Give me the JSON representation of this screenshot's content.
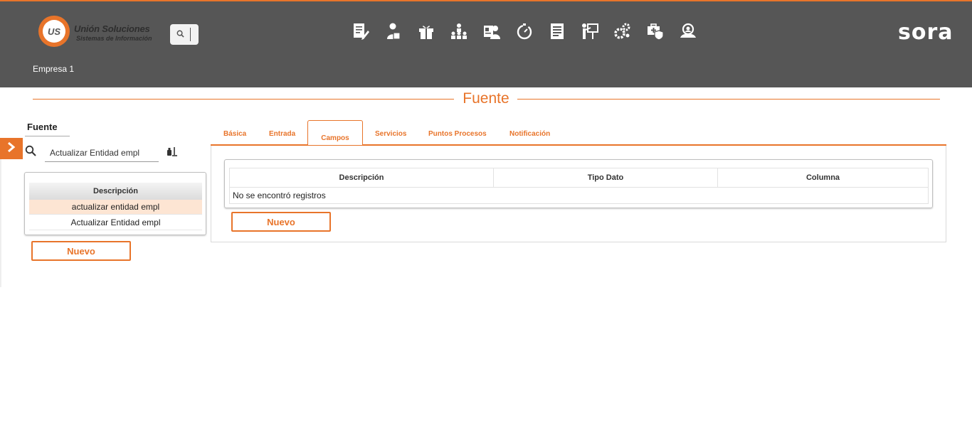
{
  "header": {
    "logo_title": "Unión Soluciones",
    "logo_subtitle": "Sistemas de Información",
    "logo_mark": "US",
    "brand": "sora",
    "company": "Empresa 1",
    "nav_icons": [
      "document-edit-icon",
      "employee-icon",
      "gift-icon",
      "hierarchy-icon",
      "contact-card-icon",
      "timer-icon",
      "report-icon",
      "presentation-icon",
      "settings-gears-icon",
      "medical-shield-icon",
      "user-search-icon"
    ]
  },
  "page": {
    "title": "Fuente"
  },
  "left_panel": {
    "heading": "Fuente",
    "search_value": "Actualizar Entidad empl",
    "grid_header": "Descripción",
    "rows": [
      "actualizar entidad empl",
      "Actualizar Entidad empl"
    ],
    "new_button": "Nuevo"
  },
  "tabs": [
    "Básica",
    "Entrada",
    "Campos",
    "Servicios",
    "Puntos Procesos",
    "Notificación"
  ],
  "active_tab": "Campos",
  "fields_grid": {
    "columns": [
      "Descripción",
      "Tipo Dato",
      "Columna"
    ],
    "empty_message": "No se encontró registros",
    "new_button": "Nuevo"
  },
  "colors": {
    "accent": "#e8742a",
    "header_bg": "#565656",
    "selected_row": "#fde5d3"
  }
}
